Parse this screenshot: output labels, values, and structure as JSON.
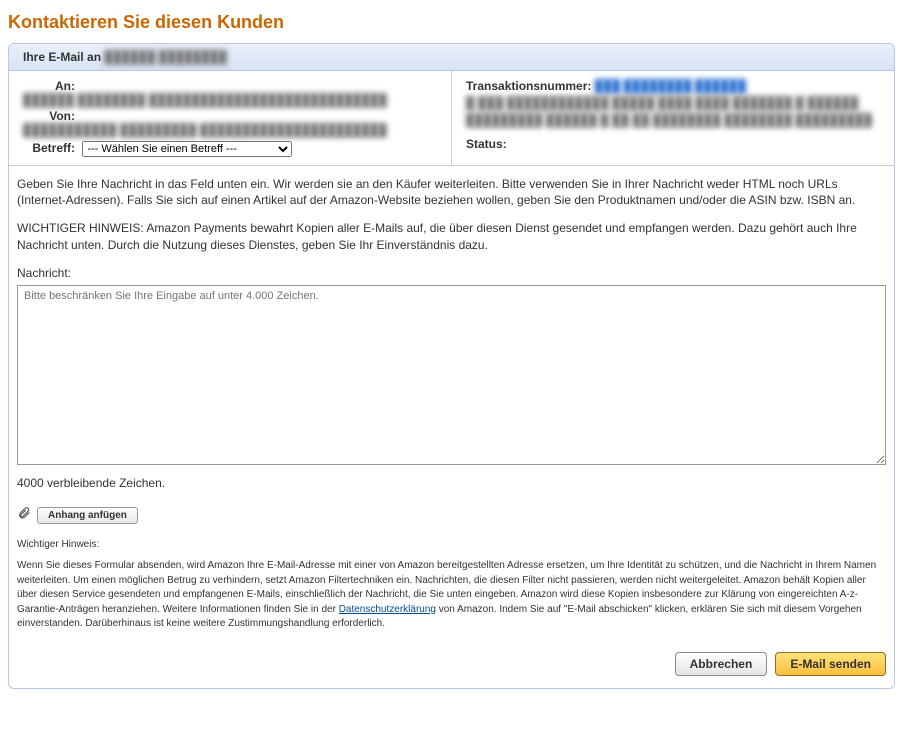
{
  "title": "Kontaktieren Sie diesen Kunden",
  "header": {
    "prefix": "Ihre E-Mail an",
    "recipient_masked": "██████ ████████"
  },
  "left": {
    "to_label": "An:",
    "to_value_masked": "██████ ████████  ████████████████████████████",
    "from_label": "Von:",
    "from_value_masked": "███████████ █████████  ██████████████████████",
    "subject_label": "Betreff:",
    "subject_selected": "--- Wählen Sie einen Betreff ---"
  },
  "right": {
    "transaction_label": "Transaktionsnummer:",
    "transaction_link_masked": "███ ████████ ██████",
    "detail_masked": "█ ███ ████████████ █████ ████ ████ ███████ █ ██████  █████████ ██████ █ ██ ██ ████████ ████████ █████████",
    "status_label": "Status:"
  },
  "body": {
    "intro": "Geben Sie Ihre Nachricht in das Feld unten ein. Wir werden sie an den Käufer weiterleiten. Bitte verwenden Sie in Ihrer Nachricht weder HTML noch URLs (Internet-Adressen). Falls Sie sich auf einen Artikel auf der Amazon-Website beziehen wollen, geben Sie den Produktnamen und/oder die ASIN bzw. ISBN an.",
    "notice": "WICHTIGER HINWEIS: Amazon Payments bewahrt Kopien aller E-Mails auf, die über diesen Dienst gesendet und empfangen werden. Dazu gehört auch Ihre Nachricht unten. Durch die Nutzung dieses Dienstes, geben Sie Ihr Einverständnis dazu.",
    "message_label": "Nachricht:",
    "message_placeholder": "Bitte beschränken Sie Ihre Eingabe auf unter 4.000 Zeichen.",
    "char_count": "4000 verbleibende Zeichen.",
    "attach_label": "Anhang anfügen",
    "hint_title": "Wichtiger Hinweis:",
    "hint_body_1": "Wenn Sie dieses Formular absenden, wird Amazon Ihre E-Mail-Adresse mit einer von Amazon bereitgestellten Adresse ersetzen, um Ihre Identität zu schützen, und die Nachricht in Ihrem Namen weiterleiten. Um einen möglichen Betrug zu verhindern, setzt Amazon Filtertechniken ein. Nachrichten, die diesen Filter nicht passieren, werden nicht weitergeleitet. Amazon behält Kopien aller über diesen Service gesendeten und empfangenen E-Mails, einschließlich der Nachricht, die Sie unten eingeben. Amazon wird diese Kopien insbesondere zur Klärung von eingereichten A-z-Garantie-Anträgen heranziehen. Weitere Informationen finden Sie in der ",
    "hint_link": "Datenschutzerklärung",
    "hint_body_2": " von Amazon. Indem Sie auf \"E-Mail abschicken\" klicken, erklären Sie sich mit diesem Vorgehen einverstanden. Darüberhinaus ist keine weitere Zustimmungshandlung erforderlich."
  },
  "buttons": {
    "cancel": "Abbrechen",
    "send": "E-Mail senden"
  }
}
